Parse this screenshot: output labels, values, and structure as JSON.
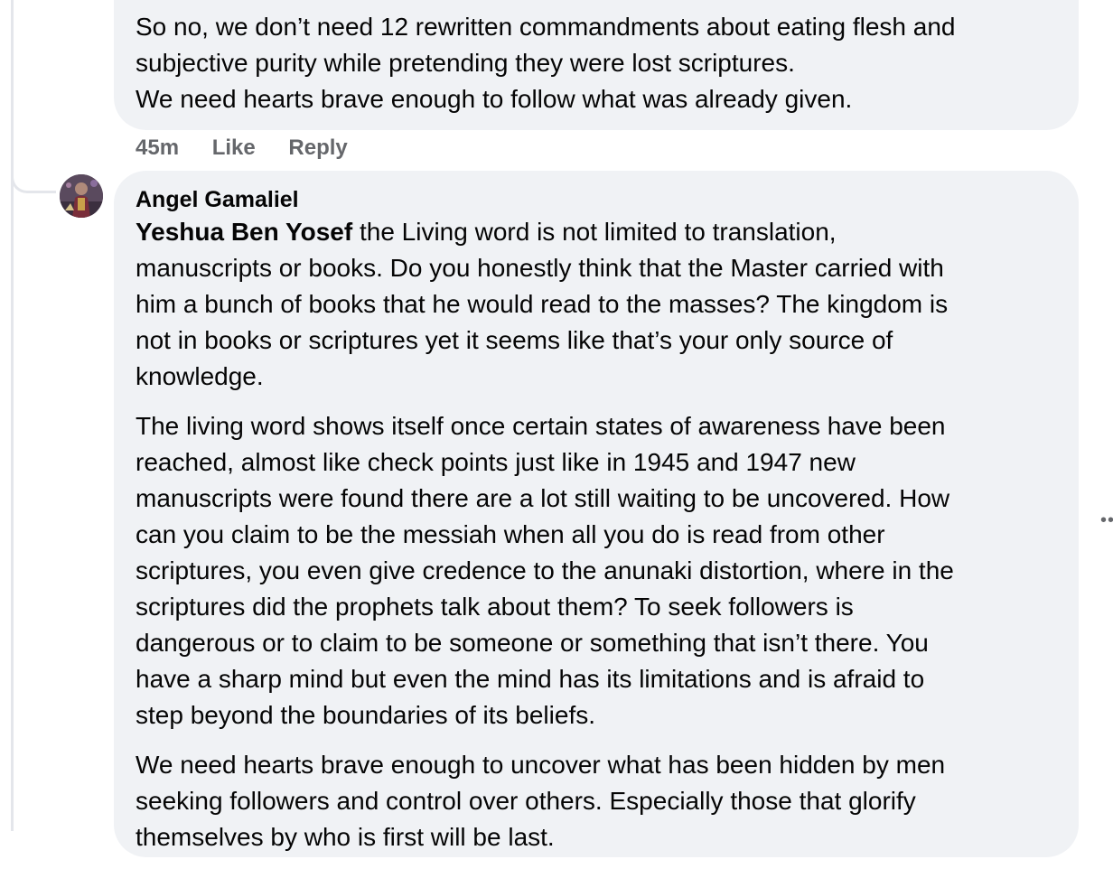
{
  "previous_comment": {
    "lines": [
      "So no, we don’t need 12 rewritten commandments about eating flesh and",
      "subjective purity while pretending they were lost scriptures.",
      "We need hearts brave enough to follow what was already given."
    ],
    "time": "45m",
    "like_label": "Like",
    "reply_label": "Reply"
  },
  "reply_comment": {
    "author": "Angel Gamaliel",
    "mention": "Yeshua Ben Yosef",
    "paragraphs": [
      [
        " the Living word is not limited to translation,",
        "manuscripts or books. Do you honestly think that the Master carried with",
        "him a bunch of books that he would read to the masses? The kingdom is",
        "not in books or scriptures yet it seems like that’s your only source of",
        "knowledge."
      ],
      [
        "The living word shows itself once certain states of awareness have been",
        "reached, almost like check points just like in 1945 and 1947 new",
        "manuscripts were found there are a lot still waiting to be uncovered. How",
        "can you claim to be the messiah when all you do is read from other",
        "scriptures, you even give credence to the anunaki distortion, where in the",
        "scriptures did the prophets talk about them? To seek followers is",
        "dangerous or to claim to be someone or something that isn’t there. You",
        "have a sharp mind but even the mind has its limitations and is afraid to",
        "step beyond the boundaries of its beliefs."
      ],
      [
        "We need hearts brave enough to uncover what has been hidden by men",
        "seeking followers and control over others. Especially those that glorify",
        "themselves by who is first will be last."
      ]
    ]
  },
  "icons": {
    "more": "more-options-icon",
    "avatar": "user-avatar"
  },
  "colors": {
    "bubble": "#f0f2f5",
    "text": "#050505",
    "meta": "#65676b",
    "thread_line": "#e4e6eb"
  }
}
